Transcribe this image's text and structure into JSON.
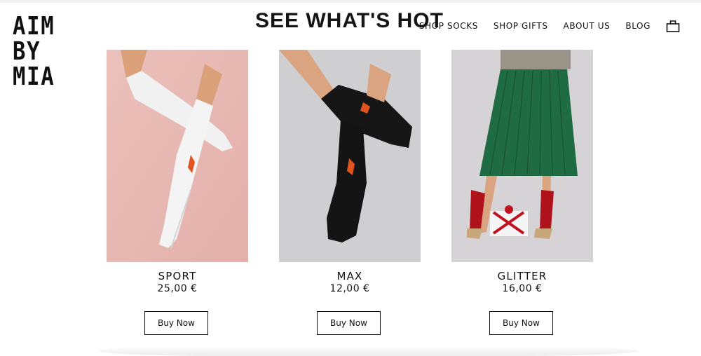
{
  "brand": {
    "logo_lines": [
      "AIM",
      "BY",
      "MIA"
    ]
  },
  "hero": {
    "title": "SEE WHAT'S HOT"
  },
  "nav": {
    "items": [
      "SHOP SOCKS",
      "SHOP GIFTS",
      "ABOUT US",
      "BLOG"
    ],
    "cart_icon": "shopping-bag-icon"
  },
  "products": [
    {
      "name": "SPORT",
      "price": "25,00 €",
      "button": "Buy Now",
      "image": "white-sock-on-pink-photo",
      "bg": "#e8b9b3"
    },
    {
      "name": "MAX",
      "price": "12,00 €",
      "button": "Buy Now",
      "image": "black-sock-on-grey-photo",
      "bg": "#cfced1"
    },
    {
      "name": "GLITTER",
      "price": "16,00 €",
      "button": "Buy Now",
      "image": "red-sock-green-skirt-photo",
      "bg": "#d5d3d5"
    }
  ],
  "colors": {
    "text": "#111111",
    "background": "#ffffff"
  }
}
